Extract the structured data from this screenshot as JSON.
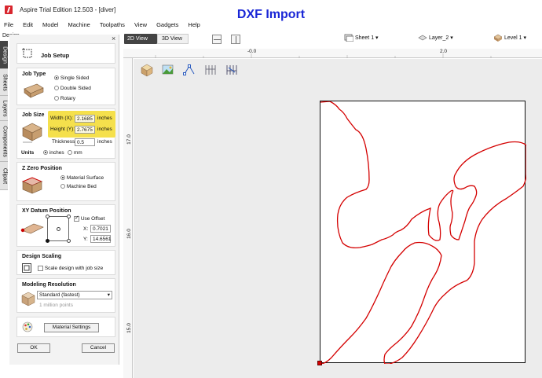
{
  "window": {
    "title": "Aspire Trial Edition 12.503 - [diver]",
    "overlay_title": "DXF Import"
  },
  "menu": [
    "File",
    "Edit",
    "Model",
    "Machine",
    "Toolpaths",
    "View",
    "Gadgets",
    "Help"
  ],
  "side_tabs": [
    "Design",
    "Sheets",
    "Layers",
    "Components",
    "Clipart"
  ],
  "panel": {
    "label": "Design",
    "close_glyph": "×",
    "job_setup_title": "Job Setup",
    "job_type": {
      "title": "Job Type",
      "options": [
        "Single Sided",
        "Double Sided",
        "Rotary"
      ],
      "selected": "Single Sided"
    },
    "job_size": {
      "title": "Job Size",
      "width_label": "Width (X):",
      "width_value": "2.1685",
      "height_label": "Height (Y):",
      "height_value": "2.7675",
      "thickness_label": "Thickness",
      "thickness_value": "0.5",
      "unit_label": "inches",
      "units_title": "Units",
      "unit_options": [
        "inches",
        "mm"
      ],
      "unit_selected": "inches",
      "highlight_color": "#f5e04c"
    },
    "z_zero": {
      "title": "Z Zero Position",
      "options": [
        "Material Surface",
        "Machine Bed"
      ],
      "selected": "Material Surface"
    },
    "xy_datum": {
      "title": "XY Datum Position",
      "use_offset_label": "Use Offset",
      "use_offset_checked": true,
      "x_label": "X:",
      "x_value": "0.7021",
      "y_label": "Y:",
      "y_value": "14.6561"
    },
    "design_scaling": {
      "title": "Design Scaling",
      "option_label": "Scale design with job size",
      "checked": false
    },
    "modeling_resolution": {
      "title": "Modeling Resolution",
      "selected": "Standard (fastest)",
      "points_text": "1 million points"
    },
    "material_settings_label": "Material Settings",
    "ok_label": "OK",
    "cancel_label": "Cancel"
  },
  "view": {
    "tab_2d": "2D View",
    "tab_3d": "3D View",
    "sheet_label": "Sheet 1",
    "layer_label": "Layer_2",
    "level_label": "Level 1",
    "dropdown_glyph": "▾"
  },
  "rulers": {
    "top": [
      "-0.0",
      "2.0"
    ],
    "left": [
      "17.0",
      "16.0",
      "15.0"
    ]
  },
  "colors": {
    "accent": "#d8262e",
    "overlay_title": "#1a27d6",
    "vector": "#d40000",
    "active_tab": "#444444"
  },
  "icons": {
    "app": "aspire-logo-icon",
    "drawing_tools": [
      "material-cube-icon",
      "image-icon",
      "node-edit-icon",
      "toolpath-icon",
      "toolpath-preview-icon"
    ]
  }
}
